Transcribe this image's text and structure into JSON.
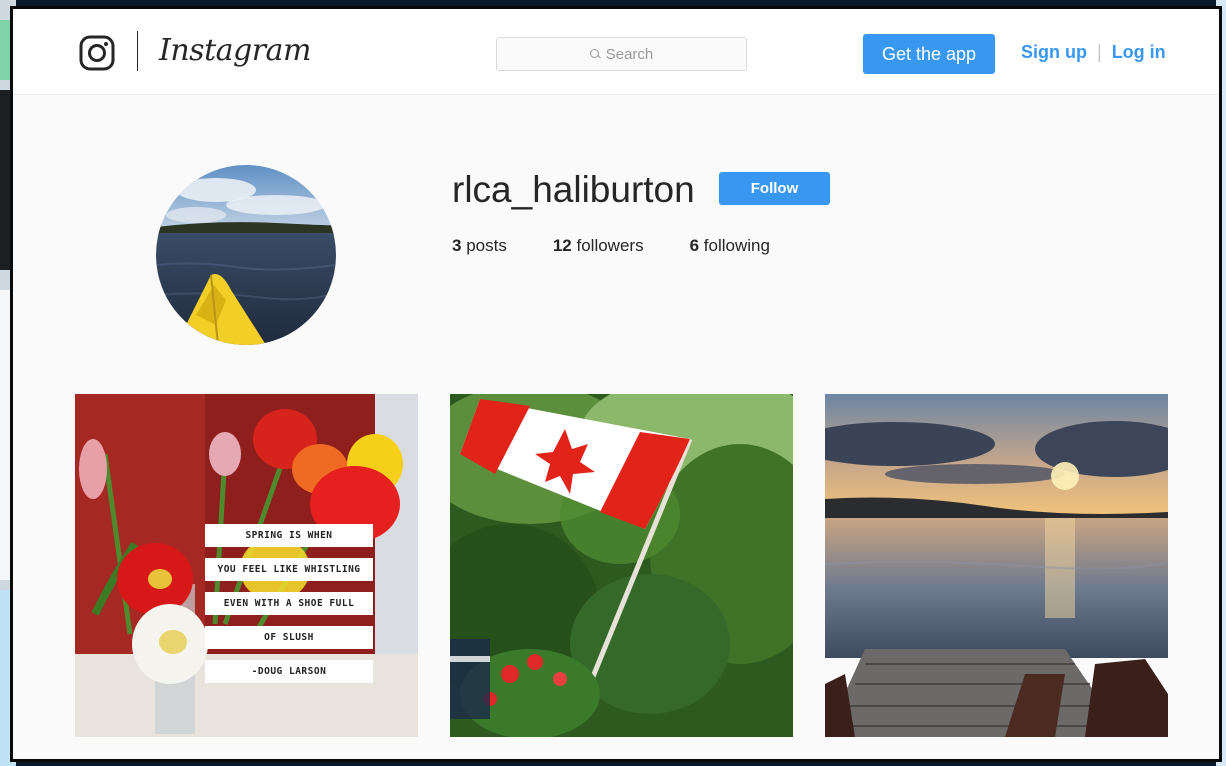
{
  "header": {
    "wordmark": "Instagram",
    "search_placeholder": "Search",
    "get_app_label": "Get the app",
    "signup_label": "Sign up",
    "login_label": "Log in",
    "separator": "|"
  },
  "profile": {
    "username": "rlca_haliburton",
    "follow_label": "Follow",
    "posts_count": "3",
    "posts_label": "posts",
    "followers_count": "12",
    "followers_label": "followers",
    "following_count": "6",
    "following_label": "following"
  },
  "posts": [
    {
      "quote_lines": [
        "SPRING IS WHEN",
        "YOU FEEL LIKE WHISTLING",
        "EVEN WITH A SHOE FULL",
        "OF SLUSH",
        "-DOUG LARSON"
      ]
    },
    {},
    {}
  ],
  "colors": {
    "accent": "#3897f0",
    "text": "#262626",
    "background": "#fafafa"
  },
  "icons": {
    "logo": "instagram-camera-icon",
    "search": "search-icon"
  }
}
